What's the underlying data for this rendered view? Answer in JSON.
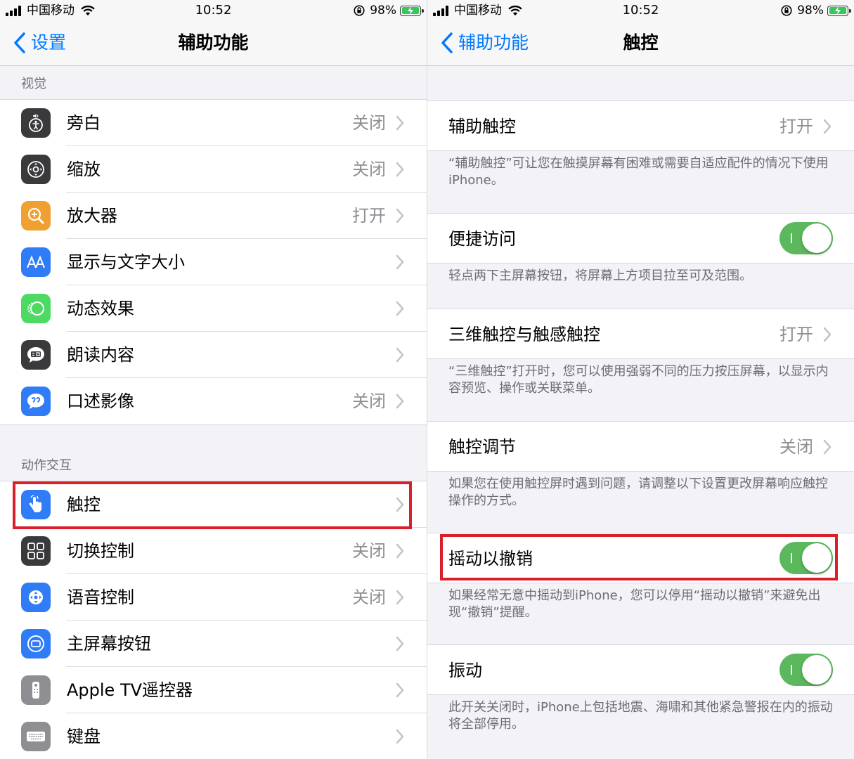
{
  "status": {
    "carrier": "中国移动",
    "time": "10:52",
    "battery_pct": "98%",
    "battery_level": 0.98,
    "colors": {
      "battery": "#34c759"
    }
  },
  "left": {
    "nav": {
      "back_label": "设置",
      "title": "辅助功能"
    },
    "sections": [
      {
        "header": "视觉",
        "items": [
          {
            "label": "旁白",
            "value": "关闭",
            "icon": "voiceover-icon",
            "color": "#3a3a3c"
          },
          {
            "label": "缩放",
            "value": "关闭",
            "icon": "zoom-icon",
            "color": "#3a3a3c"
          },
          {
            "label": "放大器",
            "value": "打开",
            "icon": "magnifier-icon",
            "color": "#f0a030"
          },
          {
            "label": "显示与文字大小",
            "value": "",
            "icon": "text-size-icon",
            "color": "#2f7cf6"
          },
          {
            "label": "动态效果",
            "value": "",
            "icon": "motion-icon",
            "color": "#4cd964"
          },
          {
            "label": "朗读内容",
            "value": "",
            "icon": "spoken-content-icon",
            "color": "#3a3a3c"
          },
          {
            "label": "口述影像",
            "value": "关闭",
            "icon": "audio-description-icon",
            "color": "#2f7cf6"
          }
        ]
      },
      {
        "header": "动作交互",
        "items": [
          {
            "label": "触控",
            "value": "",
            "icon": "touch-hand-icon",
            "color": "#2f7cf6"
          },
          {
            "label": "切换控制",
            "value": "关闭",
            "icon": "switch-control-icon",
            "color": "#3a3a3c"
          },
          {
            "label": "语音控制",
            "value": "关闭",
            "icon": "voice-control-icon",
            "color": "#2f7cf6"
          },
          {
            "label": "主屏幕按钮",
            "value": "",
            "icon": "home-button-icon",
            "color": "#2f7cf6"
          },
          {
            "label": "Apple TV遥控器",
            "value": "",
            "icon": "remote-icon",
            "color": "#8e8e93"
          },
          {
            "label": "键盘",
            "value": "",
            "icon": "keyboard-icon",
            "color": "#8e8e93"
          }
        ]
      }
    ]
  },
  "right": {
    "nav": {
      "back_label": "辅助功能",
      "title": "触控"
    },
    "cells": [
      {
        "label": "辅助触控",
        "value": "打开",
        "type": "link",
        "note": "“辅助触控”可让您在触摸屏幕有困难或需要自适应配件的情况下使用iPhone。"
      },
      {
        "label": "便捷访问",
        "type": "toggle",
        "on": true,
        "note": "轻点两下主屏幕按钮，将屏幕上方项目拉至可及范围。"
      },
      {
        "label": "三维触控与触感触控",
        "value": "打开",
        "type": "link",
        "note": "“三维触控”打开时，您可以使用强弱不同的压力按压屏幕，以显示内容预览、操作或关联菜单。"
      },
      {
        "label": "触控调节",
        "value": "关闭",
        "type": "link",
        "note": "如果您在使用触控屏时遇到问题，请调整以下设置更改屏幕响应触控操作的方式。"
      },
      {
        "label": "摇动以撤销",
        "type": "toggle",
        "on": true,
        "note": "如果经常无意中摇动到iPhone，您可以停用“摇动以撤销”来避免出现“撤销”提醒。"
      },
      {
        "label": "振动",
        "type": "toggle",
        "on": true,
        "note": "此开关关闭时，iPhone上包括地震、海啸和其他紧急警报在内的振动将全部停用。"
      }
    ],
    "colors": {
      "toggle_on": "#5cb85c",
      "highlight": "#d9202a",
      "accent": "#007aff"
    }
  }
}
